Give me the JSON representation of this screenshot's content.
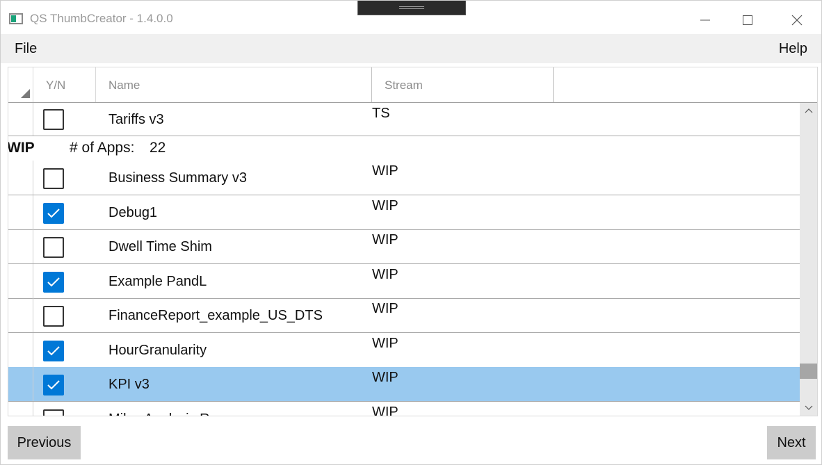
{
  "window": {
    "title": "QS ThumbCreator - 1.4.0.0",
    "controls": {
      "minimize_icon": "minimize-icon",
      "maximize_icon": "maximize-icon",
      "close_icon": "close-icon"
    }
  },
  "menu": {
    "file": "File",
    "help": "Help"
  },
  "grid": {
    "columns": {
      "yn": "Y/N",
      "name": "Name",
      "stream": "Stream"
    },
    "top_partial_row": {
      "name": "Tariffs v3",
      "stream": "TS",
      "checked": false
    },
    "group": {
      "name": "WIP",
      "count_label": "# of Apps:",
      "count_value": "22"
    },
    "rows": [
      {
        "name": "Business Summary v3",
        "stream": "WIP",
        "checked": false,
        "selected": false
      },
      {
        "name": "Debug1",
        "stream": "WIP",
        "checked": true,
        "selected": false
      },
      {
        "name": "Dwell Time Shim",
        "stream": "WIP",
        "checked": false,
        "selected": false
      },
      {
        "name": "Example PandL",
        "stream": "WIP",
        "checked": true,
        "selected": false
      },
      {
        "name": "FinanceReport_example_US_DTS",
        "stream": "WIP",
        "checked": false,
        "selected": false
      },
      {
        "name": "HourGranularity",
        "stream": "WIP",
        "checked": true,
        "selected": false
      },
      {
        "name": "KPI v3",
        "stream": "WIP",
        "checked": true,
        "selected": true
      },
      {
        "name": "Miles Analysis Roman",
        "stream": "WIP",
        "checked": false,
        "selected": false
      }
    ],
    "scroll_position": 0.92,
    "selected_color": "#99c9ef",
    "check_color": "#0078d7"
  },
  "buttons": {
    "previous": "Previous",
    "next": "Next"
  }
}
